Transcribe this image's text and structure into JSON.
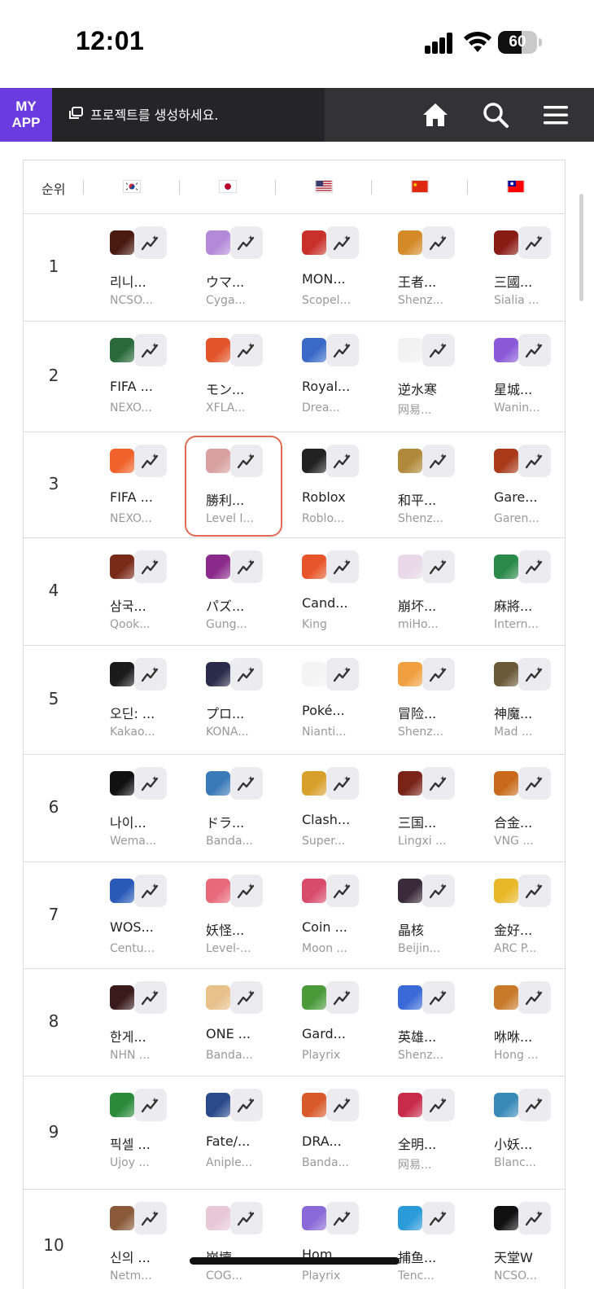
{
  "status_bar": {
    "time": "12:01",
    "battery": "60"
  },
  "header": {
    "my_app_label": "MY\nAPP",
    "project_prompt": "프로젝트를 생성하세요."
  },
  "table": {
    "rank_header": "순위",
    "countries": [
      {
        "code": "kr",
        "icon": "korea-flag-icon"
      },
      {
        "code": "jp",
        "icon": "japan-flag-icon"
      },
      {
        "code": "us",
        "icon": "usa-flag-icon"
      },
      {
        "code": "cn",
        "icon": "china-flag-icon"
      },
      {
        "code": "tw",
        "icon": "taiwan-flag-icon"
      }
    ],
    "rows": [
      {
        "rank": "1",
        "apps": [
          {
            "name": "리니...",
            "dev": "NCSO...",
            "color": "#4a1a10"
          },
          {
            "name": "ウマ...",
            "dev": "Cyga...",
            "color": "#b48ad8"
          },
          {
            "name": "MON...",
            "dev": "Scopel...",
            "color": "#c8302a"
          },
          {
            "name": "王者...",
            "dev": "Shenz...",
            "color": "#d58a2a"
          },
          {
            "name": "三國...",
            "dev": "Sialia ...",
            "color": "#8a1b14"
          }
        ]
      },
      {
        "rank": "2",
        "apps": [
          {
            "name": "FIFA ...",
            "dev": "NEXO...",
            "color": "#2a6a3a"
          },
          {
            "name": "モン...",
            "dev": "XFLA...",
            "color": "#e2542a"
          },
          {
            "name": "Royal...",
            "dev": "Drea...",
            "color": "#3a6ac8"
          },
          {
            "name": "逆水寒",
            "dev": "网易...",
            "color": "#f2f2f2"
          },
          {
            "name": "星城...",
            "dev": "Wanin...",
            "color": "#8a58d8"
          }
        ]
      },
      {
        "rank": "3",
        "apps": [
          {
            "name": "FIFA ...",
            "dev": "NEXO...",
            "color": "#f0622a"
          },
          {
            "name": "勝利...",
            "dev": "Level I...",
            "color": "#d8a0a0",
            "highlighted": true
          },
          {
            "name": "Roblox",
            "dev": "Roblo...",
            "color": "#222222"
          },
          {
            "name": "和平...",
            "dev": "Shenz...",
            "color": "#b08a3a"
          },
          {
            "name": "Gare...",
            "dev": "Garen...",
            "color": "#a83a1a"
          }
        ]
      },
      {
        "rank": "4",
        "apps": [
          {
            "name": "삼국...",
            "dev": "Qook...",
            "color": "#7a2a18"
          },
          {
            "name": "パズ...",
            "dev": "Gung...",
            "color": "#8a2a8a"
          },
          {
            "name": "Cand...",
            "dev": "King",
            "color": "#e8542a"
          },
          {
            "name": "崩坏...",
            "dev": "miHo...",
            "color": "#e8d8e8"
          },
          {
            "name": "麻將...",
            "dev": "Intern...",
            "color": "#2a8a4a"
          }
        ]
      },
      {
        "rank": "5",
        "apps": [
          {
            "name": "오딘: ...",
            "dev": "Kakao...",
            "color": "#1a1a1a"
          },
          {
            "name": "プロ...",
            "dev": "KONA...",
            "color": "#2a2a4a"
          },
          {
            "name": "Poké...",
            "dev": "Nianti...",
            "color": "#f4f4f4"
          },
          {
            "name": "冒险...",
            "dev": "Shenz...",
            "color": "#f0a040"
          },
          {
            "name": "神魔...",
            "dev": "Mad ...",
            "color": "#6a5a3a"
          }
        ]
      },
      {
        "rank": "6",
        "apps": [
          {
            "name": "나이...",
            "dev": "Wema...",
            "color": "#111111"
          },
          {
            "name": "ドラ...",
            "dev": "Banda...",
            "color": "#3a7ab8"
          },
          {
            "name": "Clash...",
            "dev": "Super...",
            "color": "#d8a02a"
          },
          {
            "name": "三国...",
            "dev": "Lingxi ...",
            "color": "#7a2418"
          },
          {
            "name": "合金...",
            "dev": "VNG ...",
            "color": "#c86a1a"
          }
        ]
      },
      {
        "rank": "7",
        "apps": [
          {
            "name": "WOS...",
            "dev": "Centu...",
            "color": "#2a5ab8"
          },
          {
            "name": "妖怪...",
            "dev": "Level-...",
            "color": "#e86a7a"
          },
          {
            "name": "Coin ...",
            "dev": "Moon ...",
            "color": "#d84a6a"
          },
          {
            "name": "晶核",
            "dev": "Beijin...",
            "color": "#3a2a3a"
          },
          {
            "name": "金好...",
            "dev": "ARC P...",
            "color": "#e8b82a"
          }
        ]
      },
      {
        "rank": "8",
        "apps": [
          {
            "name": "한게...",
            "dev": "NHN ...",
            "color": "#3a1a1a"
          },
          {
            "name": "ONE ...",
            "dev": "Banda...",
            "color": "#e8c08a"
          },
          {
            "name": "Gard...",
            "dev": "Playrix",
            "color": "#4a9a3a"
          },
          {
            "name": "英雄...",
            "dev": "Shenz...",
            "color": "#3a6ad8"
          },
          {
            "name": "咻咻...",
            "dev": "Hong ...",
            "color": "#c87a2a"
          }
        ]
      },
      {
        "rank": "9",
        "apps": [
          {
            "name": "픽셀 ...",
            "dev": "Ujoy ...",
            "color": "#2a8a3a"
          },
          {
            "name": "Fate/...",
            "dev": "Aniple...",
            "color": "#2a4a8a"
          },
          {
            "name": "DRA...",
            "dev": "Banda...",
            "color": "#d85a2a"
          },
          {
            "name": "全明...",
            "dev": "网易...",
            "color": "#c82a4a"
          },
          {
            "name": "小妖...",
            "dev": "Blanc...",
            "color": "#3a8ab8"
          }
        ]
      },
      {
        "rank": "10",
        "apps": [
          {
            "name": "신의 ...",
            "dev": "Netm...",
            "color": "#8a5a3a"
          },
          {
            "name": "崩壊...",
            "dev": "COG...",
            "color": "#e8c8d8"
          },
          {
            "name": "Hom...",
            "dev": "Playrix",
            "color": "#8a6ad8"
          },
          {
            "name": "捕鱼...",
            "dev": "Tenc...",
            "color": "#2a9ad8"
          },
          {
            "name": "天堂W",
            "dev": "NCSO...",
            "color": "#111111"
          }
        ]
      }
    ]
  }
}
